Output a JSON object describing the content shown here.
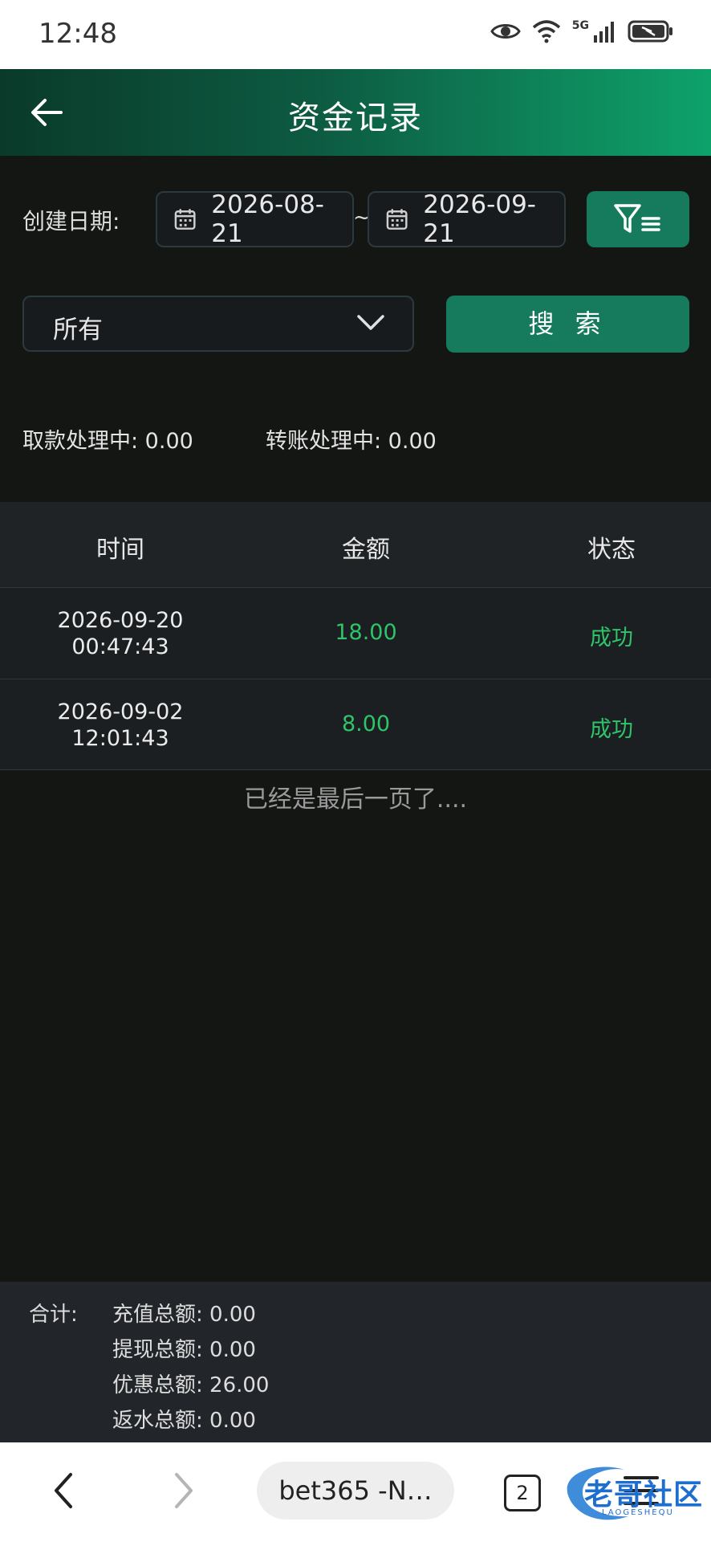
{
  "status_bar": {
    "time": "12:48",
    "network": "5G"
  },
  "header": {
    "title": "资金记录"
  },
  "filters": {
    "date_label": "创建日期:",
    "start_date": "2026-08-21",
    "separator": "~",
    "end_date": "2026-09-21",
    "type_select": "所有",
    "search_label": "搜 索"
  },
  "pending": {
    "withdraw": "取款处理中: 0.00",
    "transfer": "转账处理中: 0.00"
  },
  "table": {
    "headers": [
      "时间",
      "金额",
      "状态"
    ],
    "rows": [
      {
        "date": "2026-09-20",
        "time": "00:47:43",
        "amount": "18.00",
        "status": "成功"
      },
      {
        "date": "2026-09-02",
        "time": "12:01:43",
        "amount": "8.00",
        "status": "成功"
      }
    ],
    "end_text": "已经是最后一页了...."
  },
  "summary": {
    "label": "合计:",
    "lines": [
      "充值总额: 0.00",
      "提现总额: 0.00",
      "优惠总额: 26.00",
      "返水总额: 0.00"
    ]
  },
  "browser": {
    "url": "bet365 -N…",
    "tab_count": "2",
    "watermark_text": "老哥社区",
    "watermark_sub": "LAOGESHEQU"
  },
  "colors": {
    "accent": "#167a5c",
    "success": "#2fc46a",
    "background": "#141614"
  }
}
